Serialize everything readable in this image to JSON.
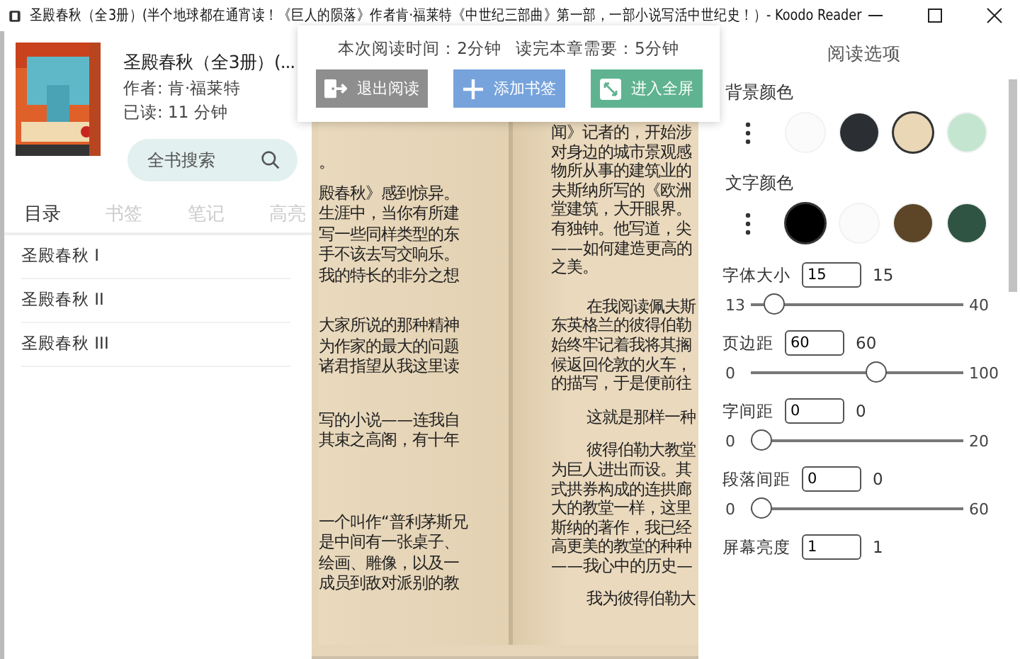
{
  "window": {
    "title": "圣殿春秋（全3册）(半个地球都在通宵读！《巨人的陨落》作者肯·福莱特《中世纪三部曲》第一部，一部小说写活中世纪史！）- Koodo Reader"
  },
  "book": {
    "title": "圣殿春秋（全3册）(...",
    "author": "作者: 肯·福莱特",
    "read_time": "已读: 11 分钟"
  },
  "search": {
    "placeholder": "全书搜索"
  },
  "tabs": [
    {
      "label": "目录",
      "selected": true
    },
    {
      "label": "书签",
      "selected": false
    },
    {
      "label": "笔记",
      "selected": false
    },
    {
      "label": "高亮",
      "selected": false
    }
  ],
  "toc": [
    "圣殿春秋 I",
    "圣殿春秋 II",
    "圣殿春秋 III"
  ],
  "popup": {
    "session_time": "本次阅读时间：2分钟",
    "remaining_time": "读完本章需要：5分钟",
    "buttons": [
      {
        "kind": "exit",
        "label": "退出阅读"
      },
      {
        "kind": "bookmark",
        "label": "添加书签"
      },
      {
        "kind": "fullscreen",
        "label": "进入全屏"
      }
    ]
  },
  "left_page": [
    {
      "indent": false,
      "lines": [
        "。"
      ]
    },
    {
      "indent": false,
      "lines": [
        "殿春秋》感到惊异。",
        "生涯中，当你有所建",
        "写一些同样类型的东",
        "手不该去写交响乐。",
        "我的特长的非分之想"
      ]
    },
    {
      "indent": false,
      "lines": [
        "大家所说的那种精神",
        "为作家的最大的问题",
        "诸君指望从我这里读"
      ]
    },
    {
      "indent": false,
      "lines": [
        "写的小说——连我自",
        "其束之高阁，有十年"
      ]
    },
    {
      "indent": false,
      "lines": [
        "一个叫作“普利茅斯兄",
        "是中间有一张桌子、",
        "绘画、雕像，以及一",
        "成员到敌对派别的教"
      ]
    }
  ],
  "right_page": [
    {
      "indent": false,
      "lines": [
        "闻》记者的，开始涉",
        "对身边的城市景观感",
        "物所从事的建筑业的",
        "夫斯纳所写的《欧洲",
        "堂建筑，大开眼界。",
        "有独钟。他写道，尖",
        "——如何建造更高的",
        "之美。"
      ]
    },
    {
      "indent": true,
      "lines": [
        "在我阅读佩夫斯",
        "东英格兰的彼得伯勒",
        "始终牢记着我将其搁",
        "候返回伦敦的火车，",
        "的描写，于是便前往"
      ]
    },
    {
      "indent": true,
      "lines": [
        "这就是那样一种"
      ]
    },
    {
      "indent": true,
      "lines": [
        "彼得伯勒大教堂",
        "为巨人进出而设。其",
        "式拱券构成的连拱廊",
        "大的教堂一样，这里",
        "斯纳的著作，我已经",
        "高更美的教堂的种种",
        "——我心中的历史—"
      ]
    },
    {
      "indent": true,
      "lines": [
        "我为彼得伯勒大"
      ]
    }
  ],
  "settings": {
    "title": "阅读选项",
    "color_groups": [
      {
        "label": "背景颜色",
        "swatches": [
          {
            "color": "#fbfbfb",
            "selected": false
          },
          {
            "color": "#2b2f33",
            "selected": false
          },
          {
            "color": "#ead7b6",
            "selected": true
          },
          {
            "color": "#c4e6d1",
            "selected": false
          }
        ]
      },
      {
        "label": "文字颜色",
        "swatches": [
          {
            "color": "#000000",
            "selected": true
          },
          {
            "color": "#fbfbfb",
            "selected": false
          },
          {
            "color": "#5c4627",
            "selected": false
          },
          {
            "color": "#2f5443",
            "selected": false
          }
        ]
      }
    ],
    "sliders": [
      {
        "label": "字体大小",
        "value": "15",
        "reading": "15",
        "min": "13",
        "max": "40",
        "level": 0.07
      },
      {
        "label": "页边距",
        "value": "60",
        "reading": "60",
        "min": "0",
        "max": "100",
        "level": 0.6
      },
      {
        "label": "字间距",
        "value": "0",
        "reading": "0",
        "min": "0",
        "max": "20",
        "level": 0
      },
      {
        "label": "段落间距",
        "value": "0",
        "reading": "0",
        "min": "0",
        "max": "60",
        "level": 0
      }
    ],
    "brightness": {
      "label": "屏幕亮度",
      "value": "1",
      "reading": "1"
    }
  }
}
